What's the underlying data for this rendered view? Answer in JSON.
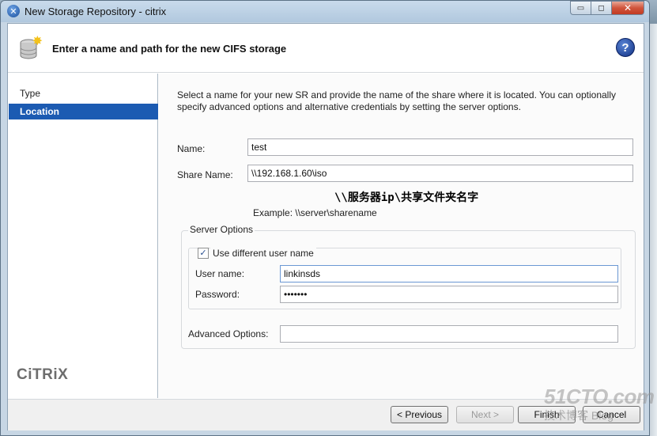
{
  "window": {
    "title": "New Storage Repository - citrix",
    "minimize_glyph": "▭",
    "maximize_glyph": "◻",
    "close_glyph": "✕",
    "app_icon_glyph": "✕"
  },
  "header": {
    "title": "Enter a name and path for the new CIFS storage",
    "help_glyph": "?",
    "icon": "storage-icon"
  },
  "nav": {
    "items": [
      {
        "label": "Type",
        "active": false
      },
      {
        "label": "Location",
        "active": true
      }
    ]
  },
  "brand": {
    "logo_text": "CiTRiX"
  },
  "form": {
    "description": "Select a name for your new SR and provide the name of the share where it is located. You can optionally specify advanced options and alternative credentials by setting the server options.",
    "name_label": "Name:",
    "name_value": "test",
    "share_label": "Share Name:",
    "share_value": "\\\\192.168.1.60\\iso",
    "share_annotation": "\\\\服务器ip\\共享文件夹名字",
    "example_text": "Example: \\\\server\\sharename",
    "server_options_title": "Server Options",
    "use_diff_user_label": "Use different user name",
    "use_diff_user_checked": true,
    "check_glyph": "✓",
    "username_label": "User name:",
    "username_value": "linkinsds",
    "password_label": "Password:",
    "password_value": "•••••••",
    "advanced_label": "Advanced Options:",
    "advanced_value": ""
  },
  "footer": {
    "previous_label": "< Previous",
    "next_label": "Next >",
    "finish_label": "Finish",
    "cancel_label": "Cancel"
  },
  "watermark": {
    "main": "51CTO.com",
    "sub": "技术博客  Blog"
  },
  "colors": {
    "accent": "#1c5bb2",
    "title_bar": "#c9dbec",
    "close_button": "#c23a22"
  }
}
